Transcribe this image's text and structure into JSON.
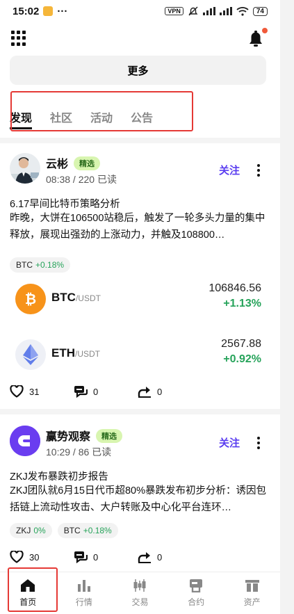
{
  "status_bar": {
    "time": "15:02",
    "dots": "···",
    "vpn": "VPN",
    "battery": "74"
  },
  "header": {
    "more_label": "更多"
  },
  "tabs": [
    {
      "label": "发现",
      "active": true
    },
    {
      "label": "社区",
      "active": false
    },
    {
      "label": "活动",
      "active": false
    },
    {
      "label": "公告",
      "active": false
    }
  ],
  "posts": [
    {
      "author": "云彬",
      "badge": "精选",
      "meta": "08:38 / 220 已读",
      "follow_label": "关注",
      "title": "6.17早间比特币策略分析",
      "body": "昨晚，大饼在106500站稳后，触发了一轮多头力量的集中释放，展现出强劲的上涨动力，并触及108800…",
      "tags": [
        {
          "symbol": "BTC",
          "change": "+0.18%"
        }
      ],
      "coins": [
        {
          "symbol": "BTC",
          "quote": "/USDT",
          "price": "106846.56",
          "change": "+1.13%",
          "color": "#f7931a"
        },
        {
          "symbol": "ETH",
          "quote": "/USDT",
          "price": "2567.88",
          "change": "+0.92%",
          "color": "#627eea"
        }
      ],
      "likes": "31",
      "comments": "0",
      "shares": "0"
    },
    {
      "author": "赢势观察",
      "badge": "精选",
      "meta": "10:29 / 86 已读",
      "follow_label": "关注",
      "title": "ZKJ发布暴跌初步报告",
      "body": "ZKJ团队就6月15日代币超80%暴跌发布初步分析：诱因包括链上流动性攻击、大户转账及中心化平台连环…",
      "tags": [
        {
          "symbol": "ZKJ",
          "change": "0%"
        },
        {
          "symbol": "BTC",
          "change": "+0.18%"
        }
      ],
      "likes": "30",
      "comments": "0",
      "shares": "0"
    }
  ],
  "nav": [
    {
      "label": "首页",
      "icon": "home-icon",
      "active": true
    },
    {
      "label": "行情",
      "icon": "market-chart-icon",
      "active": false
    },
    {
      "label": "交易",
      "icon": "candlestick-icon",
      "active": false
    },
    {
      "label": "合约",
      "icon": "contract-icon",
      "active": false
    },
    {
      "label": "资产",
      "icon": "wallet-icon",
      "active": false
    }
  ],
  "colors": {
    "accent": "#5a3df0",
    "positive": "#26a35a",
    "highlight": "#e53935",
    "badge_bg": "#d8f5b0"
  }
}
